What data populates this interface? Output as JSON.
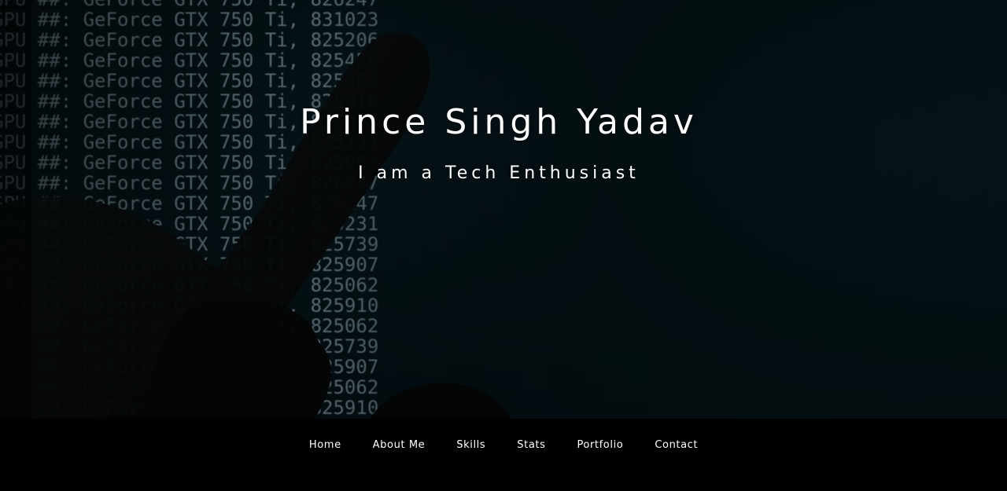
{
  "hero": {
    "title": "Prince Singh Yadav",
    "subtitle": "I am a Tech Enthusiast"
  },
  "background_terminal": {
    "rows": [
      "GPU ##: GeForce GTX 750 Ti, 826247",
      "GPU ##: GeForce GTX 750 Ti, 831023",
      "GPU ##: GeForce GTX 750 Ti, 825206",
      "GPU ##: GeForce GTX 750 Ti, 825456",
      "GPU ##: GeForce GTX 750 Ti, 825062",
      "GPU ##: GeForce GTX 750 Ti, 825910",
      "GPU ##: GeForce GTX 750 Ti, 826077",
      "GPU ##: GeForce GTX 750 Ti, 825231",
      "GPU ##: GeForce GTX 750 Ti, 825062",
      "GPU ##: GeForce GTX 750 Ti, 826247",
      "GPU ##: GeForce GTX 750 Ti, 826247",
      "GPU ##: GeForce GTX 750 Ti, 825231",
      "GPU ##: GeForce GTX 750 Ti, 825739",
      "GPU ##: GeForce GTX 750 Ti, 825907",
      "GPU ##: GeForce GTX 750 Ti, 825062",
      "GPU ##: GeForce GTX 750 Ti, 825910",
      "GPU ##: GeForce GTX 750 Ti, 825062",
      "GPU ##: GeForce GTX 750 Ti, 825739",
      "GPU ##: GeForce GTX 750 Ti, 825907",
      "GPU ##: GeForce GTX 750 Ti, 825062",
      "GPU ##: GeForce GTX 750 Ti, 825910"
    ]
  },
  "nav": {
    "items": [
      {
        "label": "Home"
      },
      {
        "label": "About Me"
      },
      {
        "label": "Skills"
      },
      {
        "label": "Stats"
      },
      {
        "label": "Portfolio"
      },
      {
        "label": "Contact"
      }
    ]
  },
  "colors": {
    "hero_bg": "#081a20",
    "nav_bg": "#000000",
    "text": "#ffffff",
    "terminal_text": "#a9c6cf"
  }
}
